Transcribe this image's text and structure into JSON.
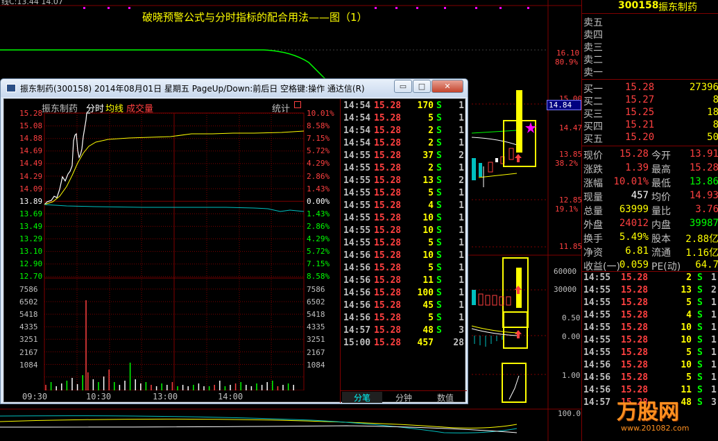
{
  "background": {
    "top_label": "线C:13.44    14.07",
    "title": "破晓预警公式与分时指标的配合用法——图（1）",
    "right_axis": [
      "16.10",
      "80.9%",
      "15.00",
      "14.47",
      "13.85",
      "38.2%",
      "12.85",
      "19.1%",
      "11.85",
      "60000",
      "30000",
      "0.50",
      "0.00",
      "1.00",
      "100.0"
    ],
    "cursor_price": "14.84"
  },
  "quote": {
    "code": "300158",
    "name": "振东制药",
    "asks": [
      {
        "label": "卖五",
        "price": "",
        "volume": ""
      },
      {
        "label": "卖四",
        "price": "",
        "volume": ""
      },
      {
        "label": "卖三",
        "price": "",
        "volume": ""
      },
      {
        "label": "卖二",
        "price": "",
        "volume": ""
      },
      {
        "label": "卖一",
        "price": "",
        "volume": ""
      }
    ],
    "bids": [
      {
        "label": "买一",
        "price": "15.28",
        "volume": "27396"
      },
      {
        "label": "买二",
        "price": "15.27",
        "volume": "8"
      },
      {
        "label": "买三",
        "price": "15.25",
        "volume": "18"
      },
      {
        "label": "买四",
        "price": "15.21",
        "volume": "8"
      },
      {
        "label": "买五",
        "price": "15.20",
        "volume": "50"
      }
    ],
    "info": [
      {
        "l1": "现价",
        "v1": "15.28",
        "c1": "#ff4040",
        "l2": "今开",
        "v2": "13.91",
        "c2": "#ff4040"
      },
      {
        "l1": "涨跌",
        "v1": "1.39",
        "c1": "#ff4040",
        "l2": "最高",
        "v2": "15.28",
        "c2": "#ff4040"
      },
      {
        "l1": "涨幅",
        "v1": "10.01%",
        "c1": "#ff4040",
        "l2": "最低",
        "v2": "13.86",
        "c2": "#00ff00"
      },
      {
        "l1": "现量",
        "v1": "457",
        "c1": "#ffffff",
        "l2": "均价",
        "v2": "14.93",
        "c2": "#ff4040"
      },
      {
        "l1": "总量",
        "v1": "63999",
        "c1": "#ffff00",
        "l2": "量比",
        "v2": "3.76",
        "c2": "#ff4040"
      },
      {
        "l1": "外盘",
        "v1": "24012",
        "c1": "#ff4040",
        "l2": "内盘",
        "v2": "39987",
        "c2": "#00ff00"
      },
      {
        "l1": "换手",
        "v1": "5.49%",
        "c1": "#ffff00",
        "l2": "股本",
        "v2": "2.88亿",
        "c2": "#ffff00"
      },
      {
        "l1": "净资",
        "v1": "6.81",
        "c1": "#ffff00",
        "l2": "流通",
        "v2": "1.16亿",
        "c2": "#ffff00"
      },
      {
        "l1": "收益(一)",
        "v1": "0.059",
        "c1": "#ffff00",
        "l2": "PE(动)",
        "v2": "64.7",
        "c2": "#ffff00"
      }
    ],
    "ticks": [
      {
        "time": "14:55",
        "price": "15.28",
        "vol": "2",
        "side": "S",
        "n": "1"
      },
      {
        "time": "14:55",
        "price": "15.28",
        "vol": "13",
        "side": "S",
        "n": "2"
      },
      {
        "time": "14:55",
        "price": "15.28",
        "vol": "5",
        "side": "S",
        "n": "1"
      },
      {
        "time": "14:55",
        "price": "15.28",
        "vol": "4",
        "side": "S",
        "n": "1"
      },
      {
        "time": "14:55",
        "price": "15.28",
        "vol": "10",
        "side": "S",
        "n": "1"
      },
      {
        "time": "14:55",
        "price": "15.28",
        "vol": "10",
        "side": "S",
        "n": "1"
      },
      {
        "time": "14:55",
        "price": "15.28",
        "vol": "5",
        "side": "S",
        "n": "1"
      },
      {
        "time": "14:56",
        "price": "15.28",
        "vol": "10",
        "side": "S",
        "n": "1"
      },
      {
        "time": "14:56",
        "price": "15.28",
        "vol": "5",
        "side": "S",
        "n": "1"
      },
      {
        "time": "14:56",
        "price": "15.28",
        "vol": "11",
        "side": "S",
        "n": "1"
      },
      {
        "time": "14:57",
        "price": "15.28",
        "vol": "48",
        "side": "S",
        "n": "3"
      }
    ],
    "watermark": "万股网",
    "watermark_url": "www.201082.com"
  },
  "window": {
    "title": "振东制药(300158) 2014年08月01日 星期五 PageUp/Down:前后日 空格键:操作 通达信(R)",
    "btn_min": "▭",
    "btn_max": "□",
    "btn_close": "✕"
  },
  "chart": {
    "stock_label": "振东制药",
    "mode_label": "分时",
    "avg_label": "均线",
    "deal_label": "成交量",
    "stats_label": "统计",
    "price_ticks": [
      "15.28",
      "15.08",
      "14.88",
      "14.69",
      "14.49",
      "14.29",
      "14.09",
      "13.89",
      "13.69",
      "13.49",
      "13.29",
      "13.10",
      "12.90",
      "12.70"
    ],
    "pct_ticks": [
      "10.01%",
      "8.58%",
      "7.15%",
      "5.72%",
      "4.29%",
      "2.86%",
      "1.43%",
      "0.00%",
      "1.43%",
      "2.86%",
      "4.29%",
      "5.72%",
      "7.15%",
      "8.58%"
    ],
    "vol_ticks": [
      "7586",
      "6502",
      "5418",
      "4335",
      "3251",
      "2167",
      "1084"
    ],
    "time_labels": [
      "09:30",
      "10:30",
      "13:00",
      "14:00"
    ]
  },
  "tick_list": {
    "rows": [
      {
        "time": "14:54",
        "price": "15.28",
        "vol": "170",
        "side": "S",
        "n": "1"
      },
      {
        "time": "14:54",
        "price": "15.28",
        "vol": "5",
        "side": "S",
        "n": "1"
      },
      {
        "time": "14:54",
        "price": "15.28",
        "vol": "2",
        "side": "S",
        "n": "1"
      },
      {
        "time": "14:54",
        "price": "15.28",
        "vol": "2",
        "side": "S",
        "n": "1"
      },
      {
        "time": "14:55",
        "price": "15.28",
        "vol": "37",
        "side": "S",
        "n": "2"
      },
      {
        "time": "14:55",
        "price": "15.28",
        "vol": "2",
        "side": "S",
        "n": "1"
      },
      {
        "time": "14:55",
        "price": "15.28",
        "vol": "13",
        "side": "S",
        "n": "2"
      },
      {
        "time": "14:55",
        "price": "15.28",
        "vol": "5",
        "side": "S",
        "n": "1"
      },
      {
        "time": "14:55",
        "price": "15.28",
        "vol": "4",
        "side": "S",
        "n": "1"
      },
      {
        "time": "14:55",
        "price": "15.28",
        "vol": "10",
        "side": "S",
        "n": "1"
      },
      {
        "time": "14:55",
        "price": "15.28",
        "vol": "10",
        "side": "S",
        "n": "1"
      },
      {
        "time": "14:55",
        "price": "15.28",
        "vol": "5",
        "side": "S",
        "n": "1"
      },
      {
        "time": "14:56",
        "price": "15.28",
        "vol": "10",
        "side": "S",
        "n": "1"
      },
      {
        "time": "14:56",
        "price": "15.28",
        "vol": "5",
        "side": "S",
        "n": "1"
      },
      {
        "time": "14:56",
        "price": "15.28",
        "vol": "11",
        "side": "S",
        "n": "1"
      },
      {
        "time": "14:56",
        "price": "15.28",
        "vol": "100",
        "side": "S",
        "n": "1"
      },
      {
        "time": "14:56",
        "price": "15.28",
        "vol": "45",
        "side": "S",
        "n": "1"
      },
      {
        "time": "14:56",
        "price": "15.28",
        "vol": "5",
        "side": "S",
        "n": "1"
      },
      {
        "time": "14:57",
        "price": "15.28",
        "vol": "48",
        "side": "S",
        "n": "3"
      },
      {
        "time": "15:00",
        "price": "15.28",
        "vol": "457",
        "side": "",
        "n": "28"
      }
    ],
    "tabs": [
      "分笔",
      "分钟",
      "数值"
    ]
  },
  "colors": {
    "up": "#ff4040",
    "down": "#00ff00",
    "grid": "#800000",
    "price_line": "#ffffff",
    "avg_line": "#ffff00",
    "highlight": "#ffff00"
  }
}
